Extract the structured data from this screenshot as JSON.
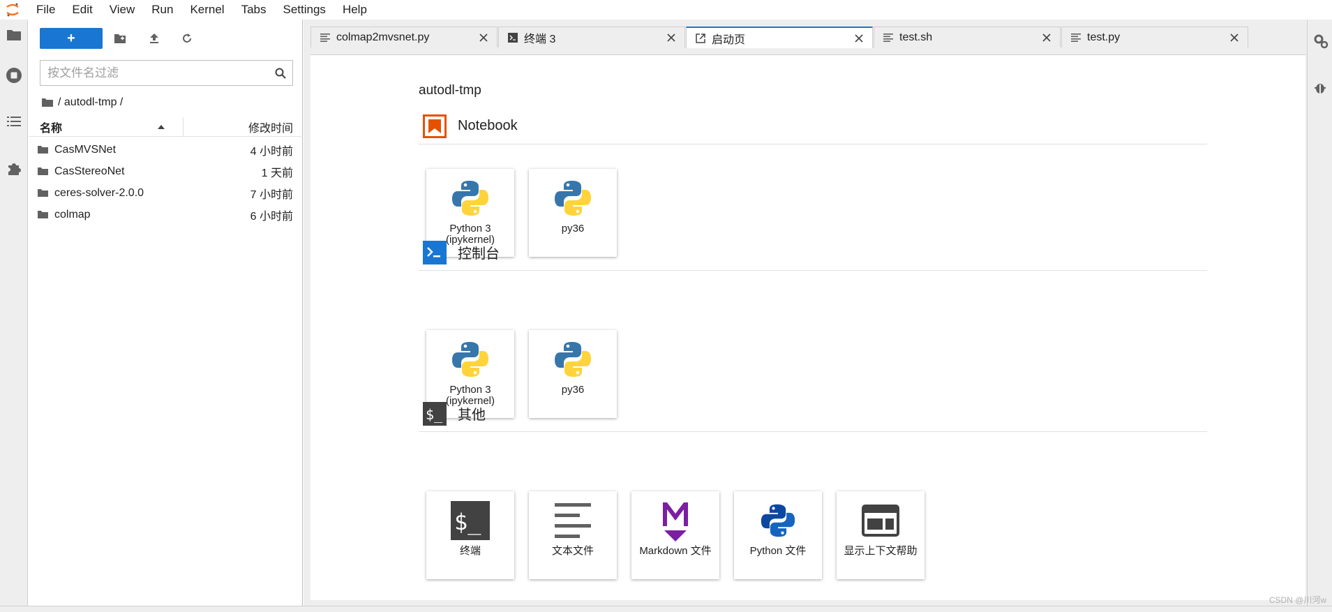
{
  "menubar": {
    "items": [
      "File",
      "Edit",
      "View",
      "Run",
      "Kernel",
      "Tabs",
      "Settings",
      "Help"
    ]
  },
  "activity_bar": {
    "icons": [
      "folder-icon",
      "running-icon",
      "toc-icon",
      "extension-icon"
    ]
  },
  "file_browser": {
    "new_launcher_label": "+",
    "filter_placeholder": "按文件名过滤",
    "breadcrumb": "/ autodl-tmp /",
    "columns": {
      "name": "名称",
      "modified": "修改时间"
    },
    "files": [
      {
        "name": "CasMVSNet",
        "modified": "4 小时前"
      },
      {
        "name": "CasStereoNet",
        "modified": "1 天前"
      },
      {
        "name": "ceres-solver-2.0.0",
        "modified": "7 小时前"
      },
      {
        "name": "colmap",
        "modified": "6 小时前"
      }
    ]
  },
  "tabs": [
    {
      "label": "colmap2mvsnet.py",
      "icon": "text-file-icon",
      "active": false
    },
    {
      "label": "终端 3",
      "icon": "terminal-icon",
      "active": false
    },
    {
      "label": "启动页",
      "icon": "launcher-icon",
      "active": true
    },
    {
      "label": "test.sh",
      "icon": "text-file-icon",
      "active": false
    },
    {
      "label": "test.py",
      "icon": "text-file-icon",
      "active": false
    }
  ],
  "launcher": {
    "cwd": "autodl-tmp",
    "sections": {
      "notebook": {
        "title": "Notebook",
        "cards": [
          {
            "label": "Python 3 (ipykernel)",
            "icon": "python-logo-icon"
          },
          {
            "label": "py36",
            "icon": "python-logo-icon"
          }
        ]
      },
      "console": {
        "title": "控制台",
        "cards": [
          {
            "label": "Python 3 (ipykernel)",
            "icon": "python-logo-icon"
          },
          {
            "label": "py36",
            "icon": "python-logo-icon"
          }
        ]
      },
      "other": {
        "title": "其他",
        "cards": [
          {
            "label": "终端",
            "icon": "terminal-icon"
          },
          {
            "label": "文本文件",
            "icon": "text-file-icon"
          },
          {
            "label": "Markdown 文件",
            "icon": "markdown-icon"
          },
          {
            "label": "Python 文件",
            "icon": "python-file-icon"
          },
          {
            "label": "显示上下文帮助",
            "icon": "context-help-icon"
          }
        ]
      }
    }
  },
  "watermark": "CSDN @川河w",
  "colors": {
    "accent": "#1976d2",
    "notebook_icon": "#e65100",
    "console_icon": "#1976d2",
    "other_icon": "#424242",
    "markdown": "#7b1fa2",
    "python_blue": "#3776ab",
    "python_yellow": "#ffd43b"
  }
}
